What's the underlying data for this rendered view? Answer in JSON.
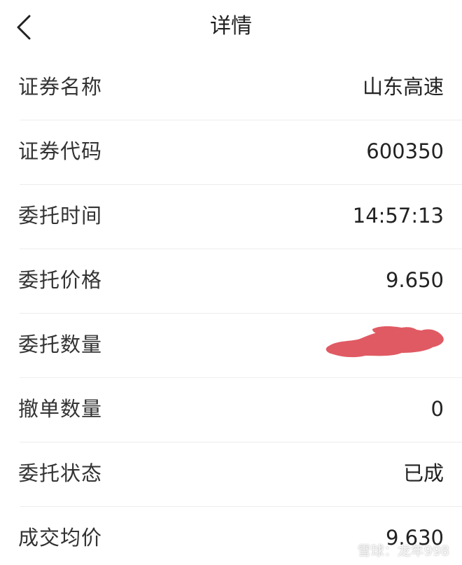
{
  "header": {
    "title": "详情",
    "back_icon": "chevron-left-icon"
  },
  "rows": [
    {
      "label": "证券名称",
      "value": "山东高速"
    },
    {
      "label": "证券代码",
      "value": "600350"
    },
    {
      "label": "委托时间",
      "value": "14:57:13"
    },
    {
      "label": "委托价格",
      "value": "9.650"
    },
    {
      "label": "委托数量",
      "value": "",
      "redacted": true
    },
    {
      "label": "撤单数量",
      "value": "0"
    },
    {
      "label": "委托状态",
      "value": "已成"
    },
    {
      "label": "成交均价",
      "value": "9.630"
    }
  ],
  "redaction_color": "#e05a63",
  "watermark": {
    "brand": "雪球",
    "user": "龙年998",
    "text": "雪球：龙年998"
  }
}
